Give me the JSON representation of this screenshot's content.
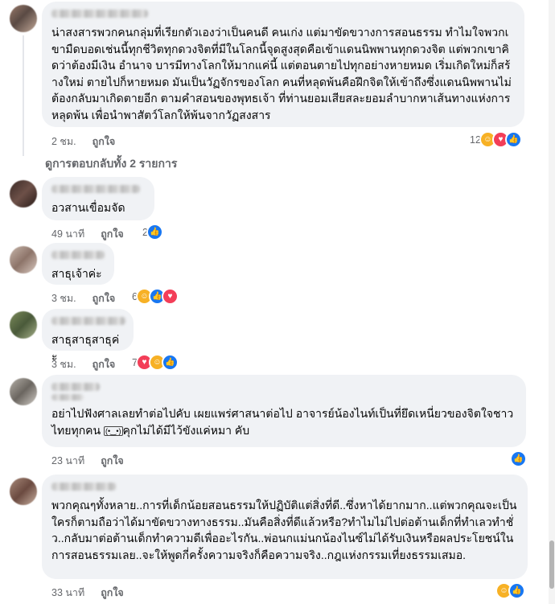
{
  "actions": {
    "time_like": "ถูกใจ"
  },
  "replies_link": "ดูการตอบกลับทั้ง 2 รายการ",
  "emoji_box": "(•‿•)",
  "icons": {
    "like": "thumbs-up-icon",
    "love": "heart-icon",
    "haha": "laughing-face-icon"
  },
  "colors": {
    "bubble": "#f0f2f5",
    "like_blue": "#1877f2",
    "love_red": "#f33e58",
    "haha_yellow": "#f7b125",
    "meta_gray": "#65676b"
  },
  "comments": [
    {
      "text": "น่าสงสารพวกคนกลุ่มที่เรียกตัวเองว่าเป็นคนดี คนเก่ง แต่มาขัดขวางการสอนธรรม ทำไมใจพวกเขามืดบอดเช่นนี้ทุกชีวิตทุกดวงจิตที่มีในโลกนี้จุดสูงสุดคือเข้าแดนนิพพานทุกดวงจิต แต่พวกเขาคิดว่าต้องมีเงิน อำนาจ บารมีทางโลกให้มากแค่นี้ แต่ตอนตายไปทุกอย่างหายหมด เริ่มเกิดใหม่ก็สร้างใหม่ ตายไปก็หายหมด มันเป็นวัฏจักรของโลก คนที่หลุดพ้นคือฝึกจิตให้เข้าถึงซึ่งแดนนิพพานไม่ต้องกลับมาเกิดตายอีก ตามคำสอนของพุทธเจ้า ที่ท่านยอมเสียสละยอมลำบากหาเส้นทางแห่งการหลุดพ้น เพื่อนำพาสัตว์โลกให้พ้นจากวัฏสงสาร",
      "time": "2 ชม.",
      "like": "ถูกใจ",
      "reaction_count": "12"
    },
    {
      "text": "อวสานเขื่อมจัด",
      "time": "49 นาที",
      "like": "ถูกใจ",
      "reaction_count": "2"
    },
    {
      "text": "สาธุเจ้าค่ะ",
      "time": "3 ชม.",
      "like": "ถูกใจ",
      "reaction_count": "6"
    },
    {
      "text": "สาธุสาธุสาธุค่ะ",
      "time": "3 ชม.",
      "like": "ถูกใจ",
      "reaction_count": "7"
    },
    {
      "text_a": "อย่าไปฟังศาลเลยทำต่อไปคับ เผยแพร่ศาสนาต่อไป อาจารย์น้องไนท์เป็นที่ยึดเหนี่ยวของจิตใจชาวไทยทุกคน",
      "text_b": "คุกไม่ได้มีไว้ขังแค่หมา คับ",
      "time": "23 นาที",
      "like": "ถูกใจ"
    },
    {
      "text": "พวกคุณๆทั้งหลาย..การที่เด็กน้อยสอนธรรมให้ปฏิบัติแต่สิ่งที่ดี..ซึ่งหาได้ยากมาก..แต่พวกคุณจะเป็นใครก็ตามถือว่าได้มาขัดขวางทางธรรม..มันคือสิ่งที่ดีแล้วหรือ?ทำไมไม่ไปต่อต้านเด็กที่ทำเลวทำชั่ว..กลับมาต่อต้านเด็กทำความดีเพื่ออะไรกัน..พ่อนกแม่นกน้องไนซ์ไม่ได้รับเงินหรือผลประโยชน์ในการสอนธรรมเลย..จะให้พูดกี่ครั้งความจริงก็คือความจริง..กฎแห่งกรรมเที่ยงธรรมเสมอ.",
      "time": "33 นาที",
      "like": "ถูกใจ"
    }
  ]
}
